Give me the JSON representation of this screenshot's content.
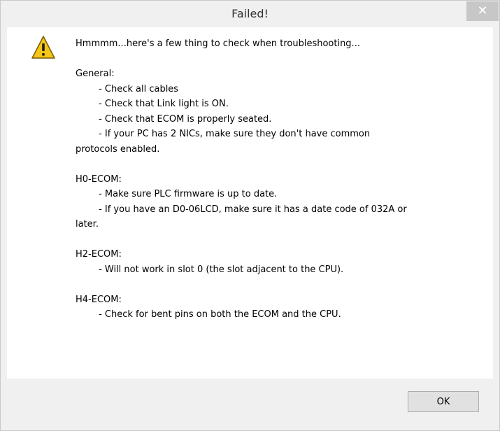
{
  "window": {
    "title": "Failed!",
    "close_label": "✕"
  },
  "dialog": {
    "icon": "warning-icon",
    "message": "Hmmmm...here's a few thing to check when troubleshooting...\n\nGeneral:\n        - Check all cables\n        - Check that Link light is ON.\n        - Check that ECOM is properly seated.\n        - If your PC has 2 NICs, make sure they don't have common\nprotocols enabled.\n\nH0-ECOM:\n        - Make sure PLC firmware is up to date.\n        - If you have an D0-06LCD, make sure it has a date code of 032A or\nlater.\n\nH2-ECOM:\n        - Will not work in slot 0 (the slot adjacent to the CPU).\n\nH4-ECOM:\n        - Check for bent pins on both the ECOM and the CPU.",
    "ok_label": "OK"
  },
  "colors": {
    "warning_fill": "#f5c518",
    "warning_outline": "#7a5a00"
  }
}
